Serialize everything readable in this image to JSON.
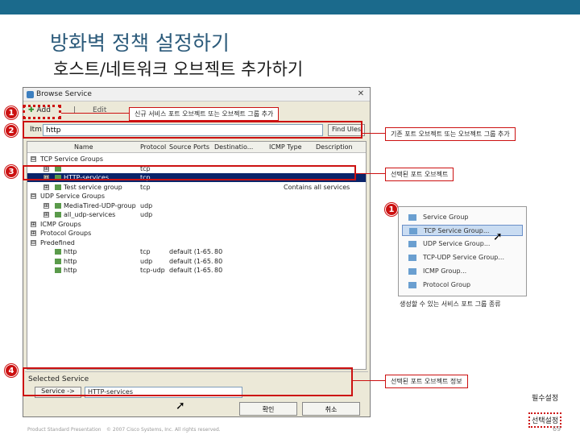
{
  "slide": {
    "title": "방화벽 정책 설정하기",
    "subtitle": "호스트/네트워크 오브젝트 추가하기",
    "footer_left": "Product Standard Presentation",
    "footer_mid": "© 2007 Cisco Systems, Inc. All rights reserved.",
    "page_number": "69",
    "accent_color": "#1b6a8c",
    "highlight_color": "#cc1111"
  },
  "window": {
    "title": "Browse Service",
    "close_glyph": "✕",
    "toolbar": {
      "add_label": "Add",
      "separator": "|",
      "edit_label": "Edit"
    },
    "filter": {
      "label": "Itm",
      "value": "http",
      "button": "Find Ules"
    },
    "columns": [
      "Name",
      "Protocol",
      "Source Ports",
      "Destinatio...",
      "ICMP Type",
      "Description"
    ],
    "rows": [
      {
        "name": "TCP Service Groups",
        "protocol": "",
        "src": "",
        "dst": "",
        "desc": "",
        "level": 0,
        "expand": "⊟"
      },
      {
        "name": "",
        "protocol": "tcp",
        "src": "",
        "dst": "",
        "desc": "",
        "level": 1,
        "expand": "⊞"
      },
      {
        "name": "HTTP-services",
        "protocol": "tcp",
        "src": "",
        "dst": "",
        "desc": "",
        "level": 1,
        "expand": "⊞",
        "selected": true
      },
      {
        "name": "Test service group",
        "protocol": "tcp",
        "src": "",
        "dst": "",
        "desc": "Contains all services",
        "level": 1,
        "expand": "⊞"
      },
      {
        "name": "UDP Service Groups",
        "protocol": "",
        "src": "",
        "dst": "",
        "desc": "",
        "level": 0,
        "expand": "⊟"
      },
      {
        "name": "MediaTired-UDP-group",
        "protocol": "udp",
        "src": "",
        "dst": "",
        "desc": "",
        "level": 1,
        "expand": "⊞"
      },
      {
        "name": "all_udp-services",
        "protocol": "udp",
        "src": "",
        "dst": "",
        "desc": "",
        "level": 1,
        "expand": "⊞"
      },
      {
        "name": "ICMP Groups",
        "protocol": "",
        "src": "",
        "dst": "",
        "desc": "",
        "level": 0,
        "expand": "⊞"
      },
      {
        "name": "Protocol Groups",
        "protocol": "",
        "src": "",
        "dst": "",
        "desc": "",
        "level": 0,
        "expand": "⊞"
      },
      {
        "name": "Predefined",
        "protocol": "",
        "src": "",
        "dst": "",
        "desc": "",
        "level": 0,
        "expand": "⊟"
      },
      {
        "name": "http",
        "protocol": "tcp",
        "src": "default (1-65...",
        "dst": "80",
        "desc": "",
        "level": 1,
        "expand": ""
      },
      {
        "name": "http",
        "protocol": "udp",
        "src": "default (1-65...",
        "dst": "80",
        "desc": "",
        "level": 1,
        "expand": ""
      },
      {
        "name": "http",
        "protocol": "tcp-udp",
        "src": "default (1-65...",
        "dst": "80",
        "desc": "",
        "level": 1,
        "expand": ""
      }
    ],
    "selected_service": {
      "label": "Selected Service",
      "button": "Service ->",
      "value": "HTTP-services"
    },
    "ok_label": "확인",
    "cancel_label": "취소"
  },
  "badges": {
    "b1": "1",
    "b2": "2",
    "b3": "3",
    "b4": "4",
    "b5": "1"
  },
  "callouts": {
    "new_object": "신규 서비스 포트 오브젝트 또는 오브젝트 그룹 추가",
    "existing_object": "기존 포트 오브젝트 또는 오브젝트 그룹 추가",
    "selected_object": "선택된 포트 오브젝트",
    "selected_info": "선택된 포트 오브젝트 정보"
  },
  "popup": {
    "items": [
      "Service Group",
      "TCP Service Group...",
      "UDP Service Group...",
      "TCP-UDP Service Group...",
      "ICMP Group...",
      "Protocol Group"
    ]
  },
  "note": "생성할 수 있는 서비스 포트 그룹 종류",
  "legend": {
    "required": "필수설정",
    "optional": "선택설정"
  }
}
